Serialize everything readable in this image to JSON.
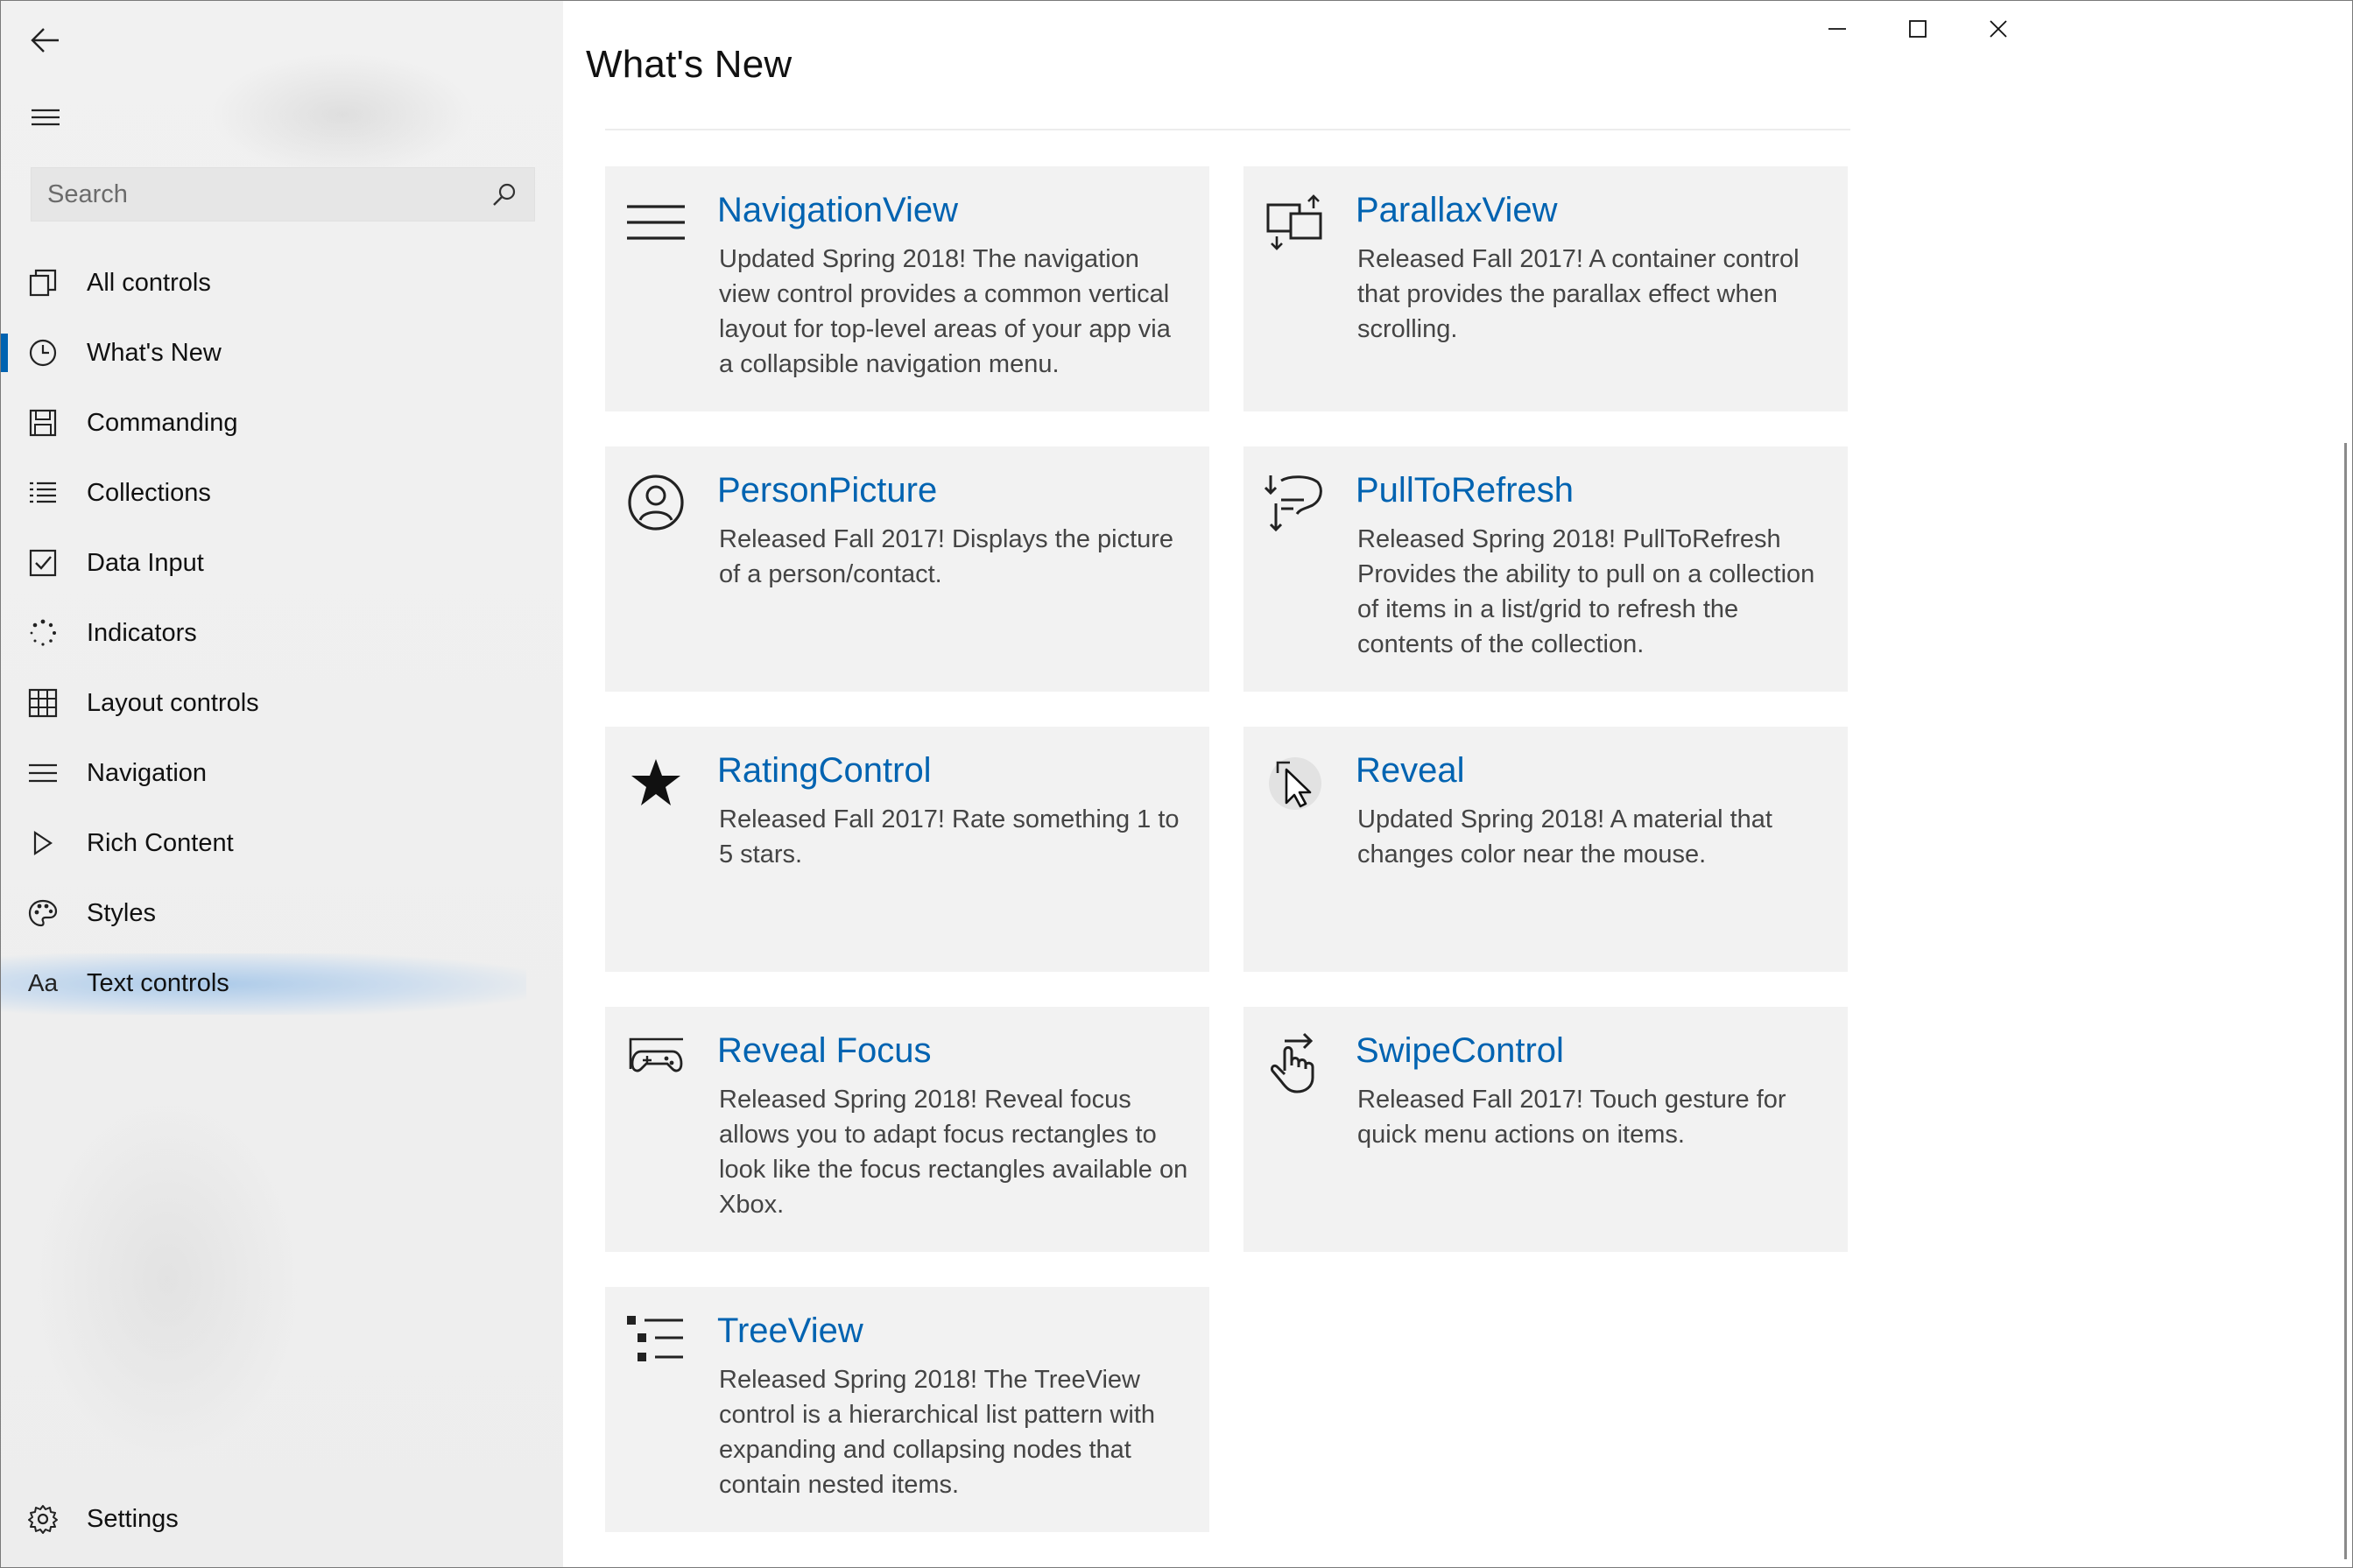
{
  "window": {
    "caption": {
      "minimize": "—",
      "maximize": "☐",
      "close": "✕"
    }
  },
  "page": {
    "title": "What's New"
  },
  "search": {
    "placeholder": "Search"
  },
  "nav": {
    "items": [
      {
        "label": "All controls",
        "icon": "all-controls-icon"
      },
      {
        "label": "What's New",
        "icon": "clock-icon",
        "selected": true
      },
      {
        "label": "Commanding",
        "icon": "save-icon"
      },
      {
        "label": "Collections",
        "icon": "list-icon"
      },
      {
        "label": "Data Input",
        "icon": "checkbox-icon"
      },
      {
        "label": "Indicators",
        "icon": "progress-ring-icon"
      },
      {
        "label": "Layout controls",
        "icon": "grid-icon"
      },
      {
        "label": "Navigation",
        "icon": "menu-icon"
      },
      {
        "label": "Rich Content",
        "icon": "play-icon"
      },
      {
        "label": "Styles",
        "icon": "palette-icon"
      },
      {
        "label": "Text controls",
        "icon": "font-icon",
        "glyph": "Aa"
      }
    ],
    "settings": {
      "label": "Settings",
      "icon": "gear-icon"
    }
  },
  "cards": [
    {
      "title": "NavigationView",
      "description": "Updated Spring 2018! The navigation view control provides a common vertical layout for top-level areas of your app via a collapsible navigation menu.",
      "icon": "hamburger-menu-icon"
    },
    {
      "title": "ParallaxView",
      "description": "Released Fall 2017! A container control that provides the parallax effect when scrolling.",
      "icon": "parallax-icon"
    },
    {
      "title": "PersonPicture",
      "description": "Released Fall 2017! Displays the picture of a person/contact.",
      "icon": "person-icon"
    },
    {
      "title": "PullToRefresh",
      "description": "Released Spring 2018! PullToRefresh Provides the ability to pull on a collection of items in a list/grid to refresh the contents of the collection.",
      "icon": "pull-to-refresh-icon"
    },
    {
      "title": "RatingControl",
      "description": "Released Fall 2017! Rate something 1 to 5 stars.",
      "icon": "star-icon"
    },
    {
      "title": "Reveal",
      "description": "Updated Spring 2018! A material that changes color near the mouse.",
      "icon": "reveal-cursor-icon"
    },
    {
      "title": "Reveal Focus",
      "description": "Released Spring 2018! Reveal focus allows you to adapt focus rectangles to look like the focus rectangles available on Xbox.",
      "icon": "gamepad-icon"
    },
    {
      "title": "SwipeControl",
      "description": "Released Fall 2017! Touch gesture for quick menu actions on items.",
      "icon": "swipe-hand-icon"
    },
    {
      "title": "TreeView",
      "description": "Released Spring 2018! The TreeView control is a hierarchical list pattern with expanding and collapsing nodes that contain nested items.",
      "icon": "tree-view-icon"
    }
  ],
  "colors": {
    "accent": "#0063b1",
    "card_bg": "#f2f2f2",
    "pane_bg": "#efefef",
    "hover_glow": "#a0c4e8"
  }
}
